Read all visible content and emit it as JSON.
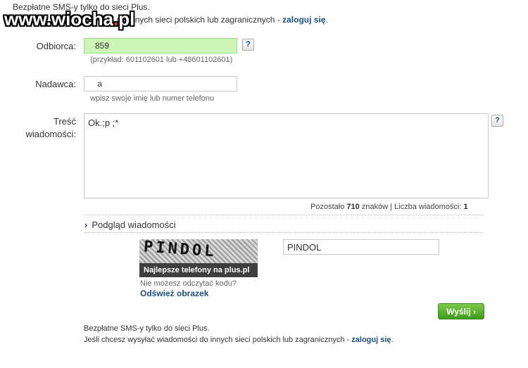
{
  "header": {
    "line1": "Bezpłatne SMS-y tylko do sieci Plus.",
    "line2_text": "ości do innych sieci polskich lub zagranicznych - ",
    "line2_link": "zaloguj się",
    "line2_end": "."
  },
  "watermark": {
    "text": "www.wiocha",
    "dot": ".",
    "tld": "pl"
  },
  "form": {
    "recipient": {
      "label": "Odbiorca:",
      "value": "   859",
      "hint": "(przykład: 601102601 lub +48601102601)",
      "help": "?"
    },
    "sender": {
      "label": "Nadawca:",
      "value": "    a",
      "hint": "wpisz swoje imię lub numer telefonu"
    },
    "message": {
      "label_line1": "Treść",
      "label_line2": "wiadomości:",
      "value": "Ok.;p ;*",
      "help": "?"
    },
    "counter": {
      "prefix": "Pozostało ",
      "remaining": "710",
      "suffix": " znaków | Liczba wiadomości: ",
      "count": "1"
    },
    "preview": {
      "chevron": "›",
      "label": "Podgląd wiadomości"
    },
    "captcha": {
      "image_text": "PINDOL",
      "banner": "Najlepsze telefony na plus.pl",
      "question": "Nie możesz odczytać kodu?",
      "refresh": "Odśwież obrazek",
      "input_value": "PINDOL"
    },
    "send": {
      "label": "Wyślij",
      "chevron": "›"
    }
  },
  "footer": {
    "line1": "Bezpłatne SMS-y tylko do sieci Plus.",
    "line2_text": "Jeśli chcesz wysyłać wiadomości do innych sieci polskich lub zagranicznych - ",
    "line2_link": "zaloguj się",
    "line2_end": "."
  },
  "colors": {
    "accent": "#1f4d7a",
    "green_field": "#cdf5b5",
    "send_button": "#4fae27"
  }
}
